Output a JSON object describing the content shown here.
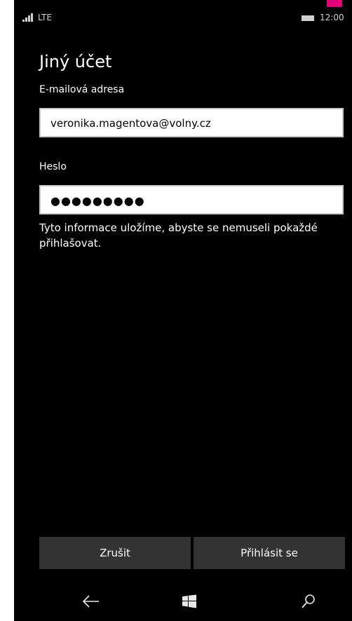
{
  "status": {
    "network": "LTE",
    "time": "12:00"
  },
  "page": {
    "title": "Jiný účet"
  },
  "form": {
    "email_label": "E-mailová adresa",
    "email_value": "veronika.magentova@volny.cz",
    "password_label": "Heslo",
    "password_mask": "●●●●●●●●●"
  },
  "hint": {
    "text": "Tyto informace uložíme, abyste se nemuseli pokaždé přihlašovat."
  },
  "buttons": {
    "cancel": "Zrušit",
    "login": "Přihlásit se"
  },
  "icons": {
    "back": "back-arrow-icon",
    "home": "windows-icon",
    "search": "search-icon",
    "signal": "signal-icon",
    "battery": "battery-icon"
  },
  "colors": {
    "accent": "#e20074",
    "background": "#000000",
    "button": "#333333"
  }
}
